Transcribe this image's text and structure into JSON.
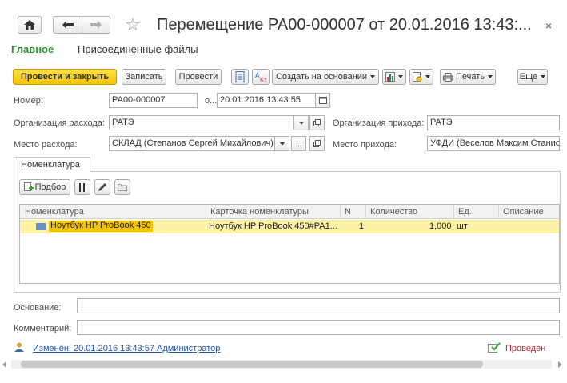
{
  "window": {
    "title": "Перемещение РА00-000007 от 20.01.2016 13:43:...",
    "close_glyph": "×"
  },
  "nav": {
    "home_icon": "home-icon",
    "back_icon": "arrow-left-icon",
    "forward_icon": "arrow-right-icon",
    "star_icon": "star-icon"
  },
  "tabs": [
    {
      "label": "Главное",
      "active": true
    },
    {
      "label": "Присоединенные файлы",
      "active": false
    }
  ],
  "toolbar": {
    "post_close": "Провести и закрыть",
    "save": "Записать",
    "post": "Провести",
    "create_based": "Создать на основании",
    "print": "Печать",
    "more": "Еще"
  },
  "form": {
    "number_label": "Номер:",
    "number_value": "РА00-000007",
    "date_label": "о...",
    "date_value": "20.01.2016 13:43:55",
    "org_out_label": "Организация расхода:",
    "org_out_value": "РАТЭ",
    "org_in_label": "Организация прихода:",
    "org_in_value": "РАТЭ",
    "place_out_label": "Место расхода:",
    "place_out_value": "СКЛАД (Степанов Сергей Михайлович)",
    "place_in_label": "Место прихода:",
    "place_in_value": "УФДИ (Веселов Максим Станис",
    "basis_label": "Основание:",
    "basis_value": "",
    "comment_label": "Комментарий:",
    "comment_value": ""
  },
  "nomenclature_tab": {
    "label": "Номенклатура",
    "pick_button": "Подбор",
    "columns": [
      "Номенклатура",
      "Карточка номенклатуры",
      "N",
      "Количество",
      "Ед.",
      "Описание"
    ],
    "rows": [
      {
        "item": "Ноутбук HP ProBook 450",
        "card": "Ноутбук HP ProBook 450#PA1...",
        "n": "1",
        "qty": "1,000",
        "unit": "шт",
        "desc": ""
      }
    ]
  },
  "footer": {
    "changed": "Изменён: 20.01.2016 13:43:57 Администратор",
    "status": "Проведен"
  },
  "colors": {
    "accent_green": "#2f8f2f",
    "primary_yellow": "#f5c400",
    "row_highlight": "#fdf2a6",
    "link_blue": "#2255aa",
    "status_red": "#b03030"
  }
}
